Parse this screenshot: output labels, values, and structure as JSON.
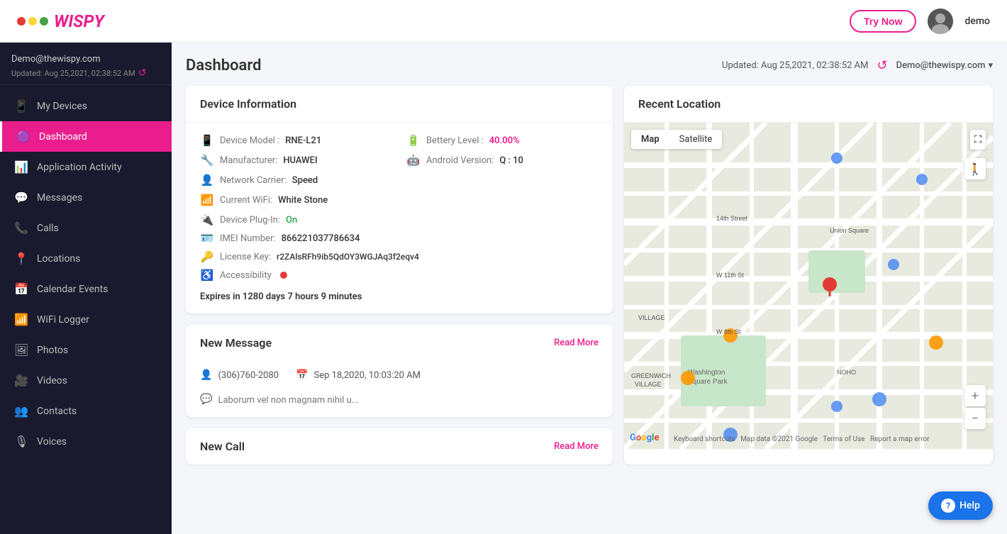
{
  "header": {
    "logo_text": "WISPY",
    "try_now_label": "Try Now",
    "user_name": "demo",
    "refresh_icon": "↺"
  },
  "sidebar": {
    "email": "Demo@thewispy.com",
    "updated": "Updated: Aug 25,2021, 02:38:52 AM",
    "nav_items": [
      {
        "id": "my-devices",
        "label": "My Devices",
        "icon": "📱",
        "active": false
      },
      {
        "id": "dashboard",
        "label": "Dashboard",
        "icon": "📊",
        "active": true
      },
      {
        "id": "application-activity",
        "label": "Application Activity",
        "icon": "📈",
        "active": false
      },
      {
        "id": "messages",
        "label": "Messages",
        "icon": "💬",
        "active": false
      },
      {
        "id": "calls",
        "label": "Calls",
        "icon": "📞",
        "active": false
      },
      {
        "id": "locations",
        "label": "Locations",
        "icon": "📍",
        "active": false
      },
      {
        "id": "calendar-events",
        "label": "Calendar Events",
        "icon": "📅",
        "active": false
      },
      {
        "id": "wifi-logger",
        "label": "WiFi Logger",
        "icon": "📶",
        "active": false
      },
      {
        "id": "photos",
        "label": "Photos",
        "icon": "🖼",
        "active": false
      },
      {
        "id": "videos",
        "label": "Videos",
        "icon": "🎥",
        "active": false
      },
      {
        "id": "contacts",
        "label": "Contacts",
        "icon": "👥",
        "active": false
      },
      {
        "id": "voices",
        "label": "Voices",
        "icon": "🎙",
        "active": false
      }
    ]
  },
  "content": {
    "page_title": "Dashboard",
    "updated_text": "Updated: Aug 25,2021, 02:38:52 AM",
    "user_dropdown": "Demo@thewispy.com"
  },
  "device_info": {
    "section_title": "Device Information",
    "device_model_label": "Device Model :",
    "device_model_value": "RNE-L21",
    "battery_label": "Bettery Level :",
    "battery_value": "40.00%",
    "manufacturer_label": "Manufacturer:",
    "manufacturer_value": "HUAWEI",
    "android_label": "Android Version:",
    "android_value": "Q : 10",
    "network_label": "Network Carrier:",
    "network_value": "Speed",
    "wifi_label": "Current WiFi:",
    "wifi_value": "White Stone",
    "plugin_label": "Device Plug-In:",
    "plugin_value": "On",
    "imei_label": "IMEI Number:",
    "imei_value": "866221037786634",
    "license_label": "License Key:",
    "license_value": "r2ZAlsRFh9ib5QdOY3WGJAq3f2eqv4",
    "accessibility_label": "Accessibility",
    "expires_text": "Expires in 1280 days 7 hours 9 minutes"
  },
  "new_message": {
    "section_title": "New Message",
    "read_more": "Read More",
    "phone": "(306)760-2080",
    "date": "Sep 18,2020, 10:03:20 AM",
    "message": "Laborum vel non magnam nihil u..."
  },
  "new_call": {
    "section_title": "New Call",
    "read_more": "Read More"
  },
  "recent_location": {
    "section_title": "Recent Location",
    "map_tab": "Map",
    "satellite_tab": "Satellite"
  },
  "map_controls": {
    "zoom_in": "+",
    "zoom_out": "−",
    "expand": "⛶",
    "person": "🚶"
  },
  "help": {
    "label": "Help",
    "icon": "?"
  }
}
